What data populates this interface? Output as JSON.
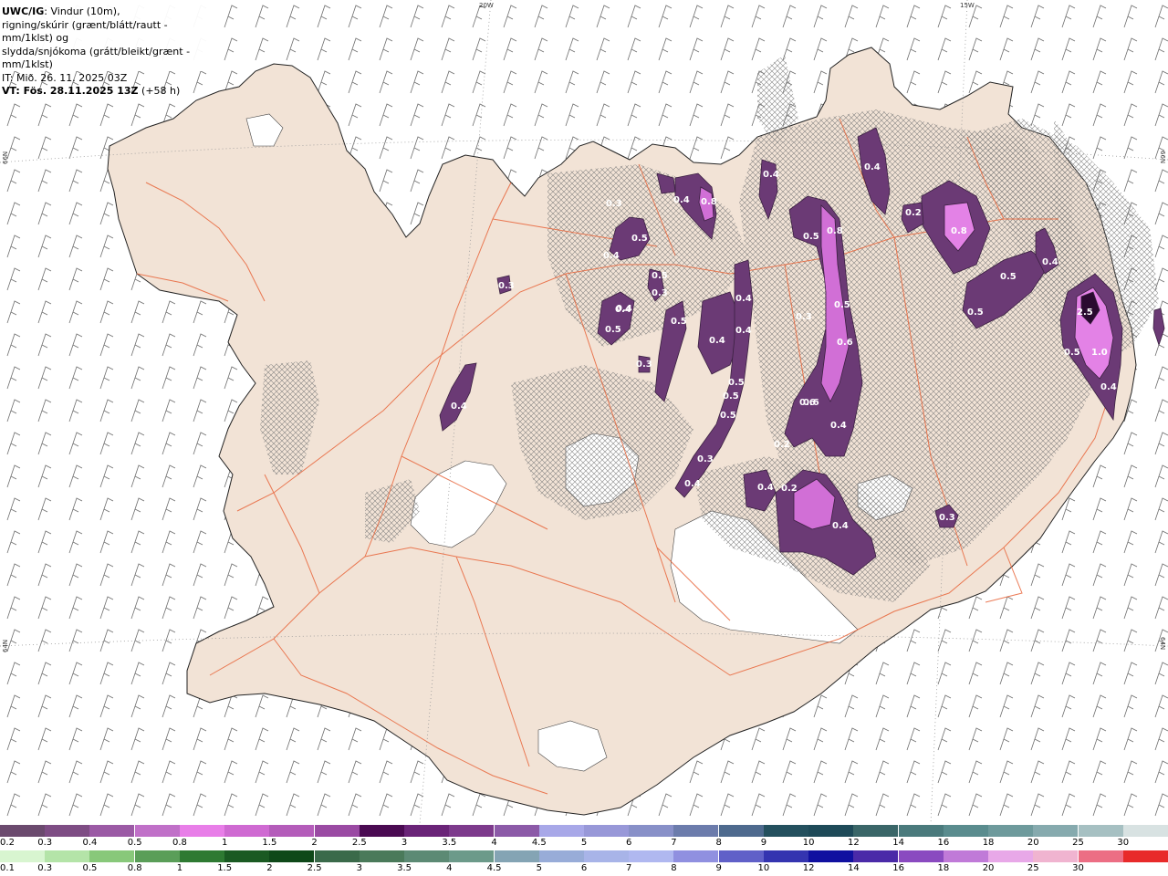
{
  "header": {
    "model": "UWC/IG",
    "line1_rest": ": Vindur (10m),",
    "line2": "rigning/skúrir (grænt/blátt/rautt - mm/1klst) og",
    "line3": "slydda/snjókoma (grátt/bleikt/grænt - mm/1klst)",
    "analysis_time": "IT: Mið. 26. 11. 2025 03Z",
    "valid_time": "VT: Fös. 28.11.2025 13Z",
    "lead_time": "(+58 h)"
  },
  "grid_labels": {
    "lon_20w": "20W",
    "lon_15w": "15W",
    "lat_66n_left": "66N",
    "lat_66n_right": "66N",
    "lat_64n_left": "64N",
    "lat_64n_right": "64N"
  },
  "precip_labels": [
    "0.3",
    "0.4",
    "0.5",
    "0.3",
    "0.4",
    "0.8",
    "0.5",
    "0.4",
    "0.4",
    "0.5",
    "0.3",
    "0.4",
    "0.4",
    "0.3",
    "0.5",
    "0.4",
    "0.3",
    "0.2",
    "0.4",
    "0.5",
    "0.8",
    "0.8",
    "0.5",
    "0.4",
    "0.5",
    "0.4",
    "0.6",
    "0.5",
    "0.5",
    "0.5",
    "0.6",
    "0.3",
    "0.4",
    "0.4",
    "0.2",
    "0.2",
    "0.4",
    "0.4",
    "0.3",
    "0.5",
    "0.5",
    "0.4",
    "2.5",
    "0.6",
    "1.0",
    "0.4"
  ],
  "legend_snow": {
    "ticks": [
      "0.2",
      "0.3",
      "0.4",
      "0.5",
      "0.8",
      "1",
      "1.5",
      "2",
      "2.5",
      "3",
      "3.5",
      "4",
      "4.5",
      "5",
      "6",
      "7",
      "8",
      "9",
      "10",
      "12",
      "14",
      "16",
      "18",
      "20",
      "25",
      "30"
    ],
    "colors": [
      "#6b4a6e",
      "#7e4d84",
      "#9b5aa5",
      "#c070c8",
      "#e87ee8",
      "#cf6ad2",
      "#b45cba",
      "#9a4aa3",
      "#4a0a52",
      "#6a2478",
      "#7d3a8c",
      "#8c5aa8",
      "#a8a8e8",
      "#9898d8",
      "#8890c8",
      "#6c7cac",
      "#4e6a8e",
      "#24505e",
      "#1e4a58",
      "#3a6668",
      "#4a7a7c",
      "#5a8c8e",
      "#6e9a9c",
      "#86aaae",
      "#a6c0c2",
      "#d8e2e2"
    ]
  },
  "legend_rain": {
    "ticks": [
      "0.1",
      "0.3",
      "0.5",
      "0.8",
      "1",
      "1.5",
      "2",
      "2.5",
      "3",
      "3.5",
      "4",
      "4.5",
      "5",
      "6",
      "7",
      "8",
      "9",
      "10",
      "12",
      "14",
      "16",
      "18",
      "20",
      "25",
      "30"
    ],
    "colors": [
      "#d8f5d0",
      "#b4e4a8",
      "#88c87a",
      "#5a9e58",
      "#2e7a32",
      "#1a5a22",
      "#0e4818",
      "#3a6a4a",
      "#4a7a5a",
      "#5c8a74",
      "#6c9a8a",
      "#84a4b4",
      "#98acd8",
      "#a8b4e8",
      "#b0b8f0",
      "#9090e0",
      "#6060c8",
      "#3434b0",
      "#1010a0",
      "#4a2aa8",
      "#8a4ac0",
      "#c07ad8",
      "#e8a8e8",
      "#f0b4d0",
      "#ec6e84",
      "#e82a2a"
    ]
  },
  "colors": {
    "land": "#f2e3d6",
    "ice": "#ffffff",
    "roads": "#e8653a",
    "hatch": "#8a8a8a"
  }
}
